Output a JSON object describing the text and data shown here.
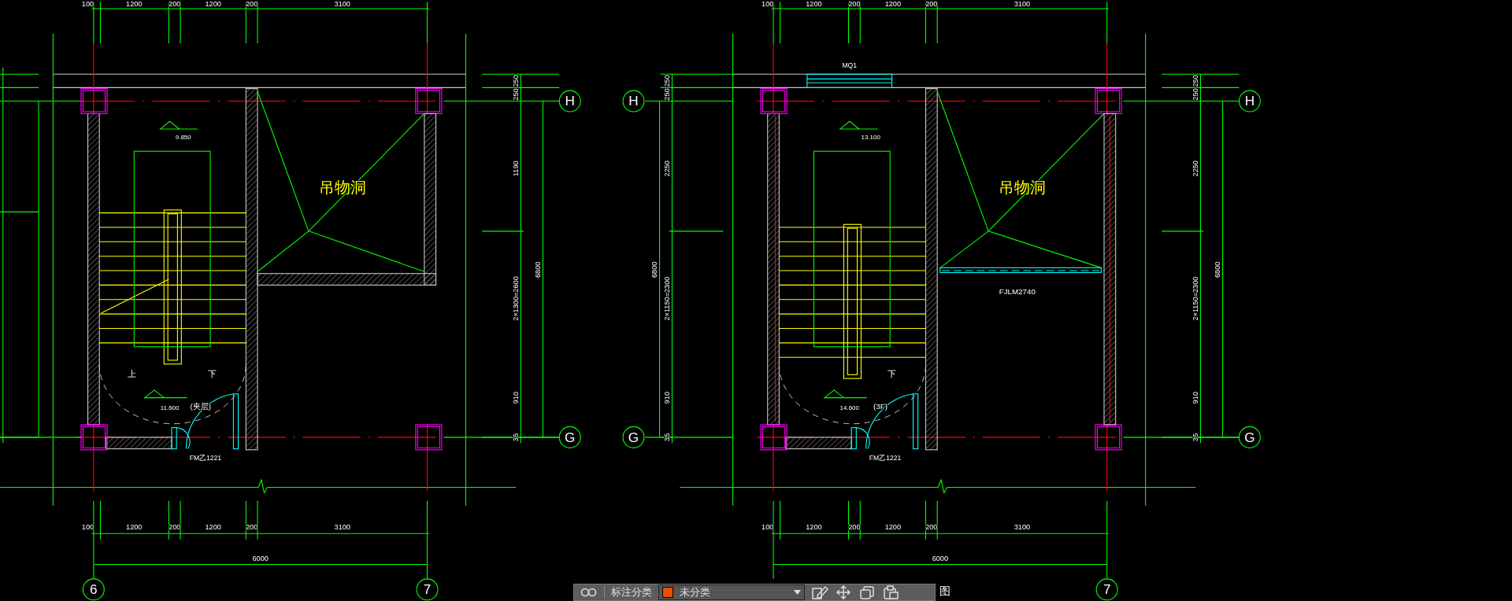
{
  "plans": [
    {
      "kind": "shaft",
      "top_dims": [
        "100",
        "1200",
        "200",
        "1200",
        "200",
        "3100"
      ],
      "bottom_dims": [
        "100",
        "1200",
        "200",
        "1200",
        "200",
        "3100"
      ],
      "total_dim": "6000",
      "side_dims": [
        "250",
        "250",
        "1190",
        "2×1300=2600",
        "910",
        "35"
      ],
      "side_total": "6800",
      "right_axes": [
        "H",
        "G"
      ],
      "bottom_left_axis": "6",
      "bottom_right_axis": "7",
      "hoist_label": "吊物洞",
      "landing_elevation": "9.850",
      "floor_elevation": "11.600",
      "floor_note": "(夹层)",
      "up_label": "上",
      "down_label": "下",
      "door_label": "FM乙1221"
    },
    {
      "kind": "opening",
      "top_dims": [
        "100",
        "1200",
        "200",
        "1200",
        "200",
        "3100"
      ],
      "bottom_dims": [
        "100",
        "1200",
        "200",
        "1200",
        "200",
        "3100"
      ],
      "total_dim": "6000",
      "side_dims": [
        "250",
        "250",
        "2250",
        "2×1150=2300",
        "910",
        "35"
      ],
      "side_total": "6800",
      "left_side_dims": [
        "250",
        "250",
        "2250",
        "2×1150=2300",
        "910",
        "35"
      ],
      "left_side_total": "6800",
      "left_axes": [
        "H",
        "G"
      ],
      "right_axes": [
        "H",
        "G"
      ],
      "bottom_right_axis": "7",
      "window_label": "MQ1",
      "hoist_label": "吊物洞",
      "opening_label": "FJLM2740",
      "landing_elevation": "13.100",
      "floor_elevation": "14.600",
      "floor_note": "(3F)",
      "down_label": "下",
      "door_label": "FM乙1221"
    }
  ],
  "toolbar": {
    "category_label": "标注分类",
    "category": {
      "value": "未分类",
      "color": "#e65100"
    }
  },
  "edge_text": "图"
}
